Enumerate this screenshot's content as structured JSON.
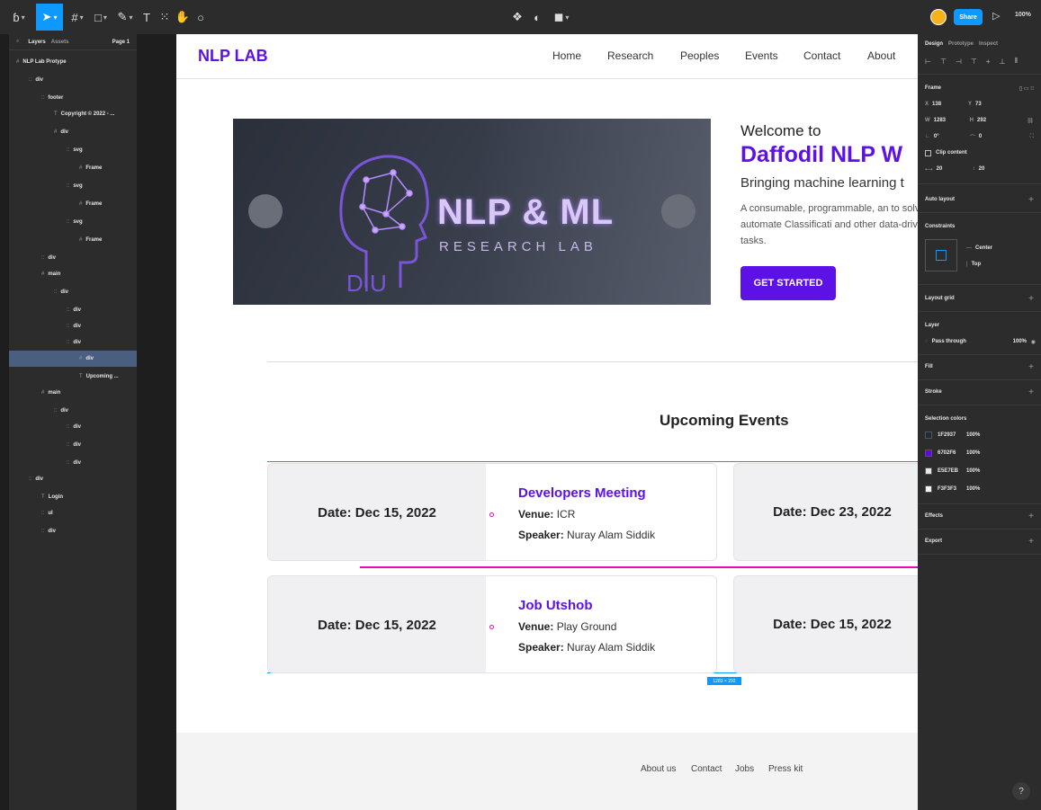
{
  "toolbar": {
    "share_label": "Share",
    "zoom_label": "100%"
  },
  "layers_panel": {
    "tab_layers": "Layers",
    "tab_assets": "Assets",
    "page_label": "Page 1",
    "items": [
      {
        "icon": "#",
        "label": "NLP Lab Protype"
      },
      {
        "icon": "::",
        "label": "div"
      },
      {
        "icon": "::",
        "label": "footer"
      },
      {
        "icon": "T",
        "label": "Copyright © 2022 - ..."
      },
      {
        "icon": "#",
        "label": "div"
      },
      {
        "icon": "::",
        "label": "svg"
      },
      {
        "icon": "#",
        "label": "Frame"
      },
      {
        "icon": "::",
        "label": "svg"
      },
      {
        "icon": "#",
        "label": "Frame"
      },
      {
        "icon": "::",
        "label": "svg"
      },
      {
        "icon": "#",
        "label": "Frame"
      },
      {
        "icon": "::",
        "label": "div"
      },
      {
        "icon": "#",
        "label": "main"
      },
      {
        "icon": "::",
        "label": "div"
      },
      {
        "icon": "::",
        "label": "div"
      },
      {
        "icon": "::",
        "label": "div"
      },
      {
        "icon": "::",
        "label": "div"
      },
      {
        "icon": "#",
        "label": "div"
      },
      {
        "icon": "T",
        "label": "Upcoming ..."
      },
      {
        "icon": "#",
        "label": "main"
      },
      {
        "icon": "::",
        "label": "div"
      },
      {
        "icon": "::",
        "label": "div"
      },
      {
        "icon": "::",
        "label": "div"
      },
      {
        "icon": "::",
        "label": "div"
      },
      {
        "icon": "::",
        "label": "div"
      },
      {
        "icon": "T",
        "label": "Login"
      },
      {
        "icon": "::",
        "label": "ul"
      },
      {
        "icon": "::",
        "label": "div"
      }
    ]
  },
  "site": {
    "brand": "NLP LAB",
    "nav": [
      "Home",
      "Research",
      "Peoples",
      "Events",
      "Contact",
      "About"
    ],
    "hero": {
      "image_title": "NLP & ML",
      "image_subtitle": "RESEARCH LAB",
      "welcome": "Welcome to",
      "title": "Daffodil NLP W",
      "tagline": "Bringing machine learning t",
      "description": "A consumable, programmable, an to solve and automate Classificati and other data-driven tasks.",
      "cta": "GET STARTED"
    },
    "events_heading": "Upcoming Events",
    "events": [
      {
        "date": "Date: Dec 15, 2022",
        "title": "Developers Meeting",
        "venue_label": "Venue:",
        "venue": "ICR",
        "speaker_label": "Speaker:",
        "speaker": "Nuray Alam Siddik",
        "side_date": "Date: Dec 23, 2022"
      },
      {
        "date": "Date: Dec 15, 2022",
        "title": "Job Utshob",
        "venue_label": "Venue:",
        "venue": "Play Ground",
        "speaker_label": "Speaker:",
        "speaker": "Nuray Alam Siddik",
        "side_date": "Date: Dec 15, 2022"
      }
    ],
    "footer_links": [
      "About us",
      "Contact",
      "Jobs",
      "Press kit"
    ]
  },
  "design_panel": {
    "tabs": [
      "Design",
      "Prototype",
      "Inspect"
    ],
    "frame_label": "Frame",
    "x_label": "X",
    "x_value": "138",
    "y_label": "Y",
    "y_value": "73",
    "w_label": "W",
    "w_value": "1283",
    "h_label": "H",
    "h_value": "292",
    "rotation": "0°",
    "radius": "0",
    "clip_content": "Clip content",
    "spacing_h": "20",
    "spacing_v": "20",
    "auto_layout": "Auto layout",
    "constraints": "Constraints",
    "constraint_h": "Center",
    "constraint_v": "Top",
    "layout_grid": "Layout grid",
    "layer": "Layer",
    "pass_through": "Pass through",
    "layer_opacity": "100%",
    "fill": "Fill",
    "stroke": "Stroke",
    "selection_colors": "Selection colors",
    "colors": [
      {
        "hex": "1F2937",
        "opacity": "100%",
        "swatch": "#1f2937"
      },
      {
        "hex": "6702F6",
        "opacity": "100%",
        "swatch": "#6702f6"
      },
      {
        "hex": "E5E7EB",
        "opacity": "100%",
        "swatch": "#e5e7eb"
      },
      {
        "hex": "F3F3F3",
        "opacity": "100%",
        "swatch": "#f3f3f3"
      }
    ],
    "effects": "Effects",
    "export": "Export"
  },
  "help_label": "?",
  "colors": {
    "accent": "#5c12e6",
    "figma_blue": "#0d99ff",
    "pink": "#e80bb7"
  }
}
